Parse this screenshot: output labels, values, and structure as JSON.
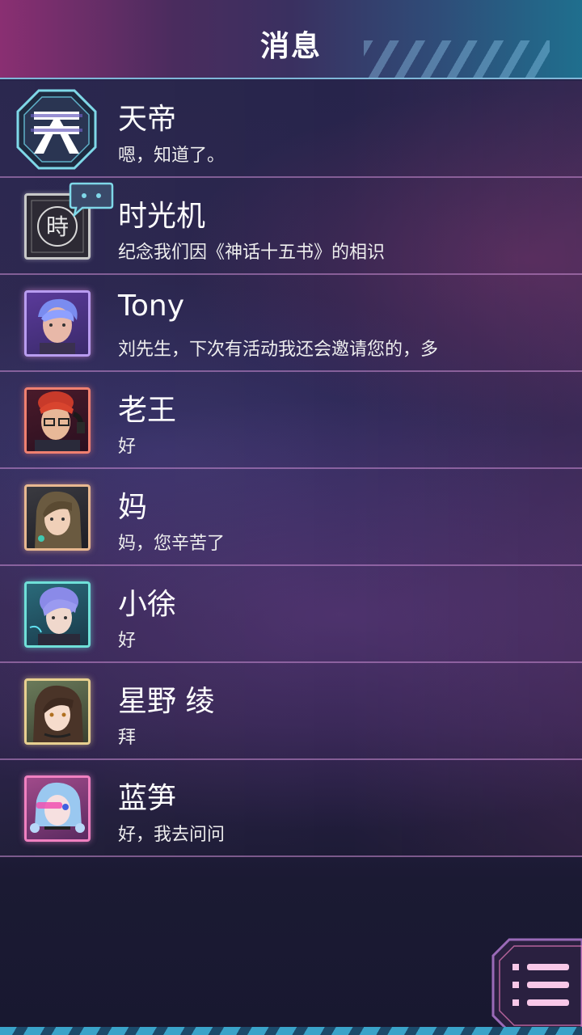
{
  "header": {
    "title": "消息"
  },
  "contacts": [
    {
      "name": "天帝",
      "message": "嗯，知道了。",
      "avatar": "tiandi-emblem-icon"
    },
    {
      "name": "时光机",
      "message": "纪念我们因《神话十五书》的相识",
      "avatar": "time-machine-icon"
    },
    {
      "name": "Tony",
      "message": "刘先生，下次有活动我还会邀请您的，多",
      "avatar": "portrait-purple-hair"
    },
    {
      "name": "老王",
      "message": "好",
      "avatar": "portrait-red-hair-glasses"
    },
    {
      "name": "妈",
      "message": "妈，您辛苦了",
      "avatar": "portrait-long-hair-woman"
    },
    {
      "name": "小徐",
      "message": "好",
      "avatar": "portrait-lavender-hair-boy"
    },
    {
      "name": "星野 绫",
      "message": "拜",
      "avatar": "portrait-brown-hair-girl"
    },
    {
      "name": "蓝笋",
      "message": "好，我去问问",
      "avatar": "portrait-blue-hair-girl"
    }
  ],
  "menu_button": {
    "icon": "menu-list-icon"
  },
  "emblem_char": "天",
  "time_machine_char": "時",
  "colors": {
    "accent_pink": "#e0a8e0",
    "accent_cyan": "#7fd8e8",
    "header_left": "#8a2f72",
    "header_right": "#1f6f8e"
  }
}
